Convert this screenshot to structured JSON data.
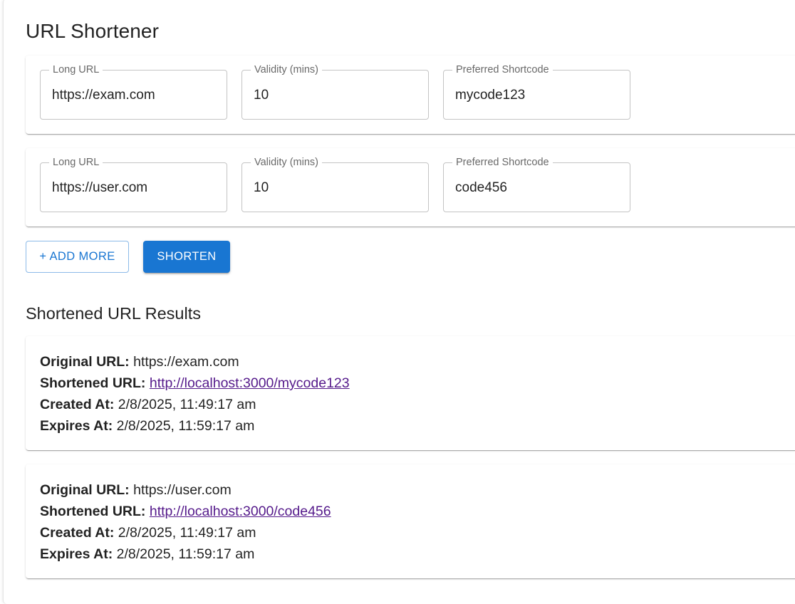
{
  "header": {
    "title": "URL Shortener"
  },
  "form": {
    "rows": [
      {
        "long_url": {
          "label": "Long URL",
          "value": "https://exam.com"
        },
        "validity": {
          "label": "Validity (mins)",
          "value": "10"
        },
        "shortcode": {
          "label": "Preferred Shortcode",
          "value": "mycode123"
        }
      },
      {
        "long_url": {
          "label": "Long URL",
          "value": "https://user.com"
        },
        "validity": {
          "label": "Validity (mins)",
          "value": "10"
        },
        "shortcode": {
          "label": "Preferred Shortcode",
          "value": "code456"
        }
      }
    ],
    "add_more_label": "+ ADD MORE",
    "shorten_label": "SHORTEN"
  },
  "results": {
    "heading": "Shortened URL Results",
    "labels": {
      "original": "Original URL:",
      "shortened": "Shortened URL:",
      "created": "Created At:",
      "expires": "Expires At:"
    },
    "items": [
      {
        "original_url": "https://exam.com",
        "short_url": "http://localhost:3000/mycode123",
        "created_at": "2/8/2025, 11:49:17 am",
        "expires_at": "2/8/2025, 11:59:17 am"
      },
      {
        "original_url": "https://user.com",
        "short_url": "http://localhost:3000/code456",
        "created_at": "2/8/2025, 11:49:17 am",
        "expires_at": "2/8/2025, 11:59:17 am"
      }
    ]
  },
  "colors": {
    "primary": "#1976d2",
    "visited_link": "#551a8b"
  }
}
